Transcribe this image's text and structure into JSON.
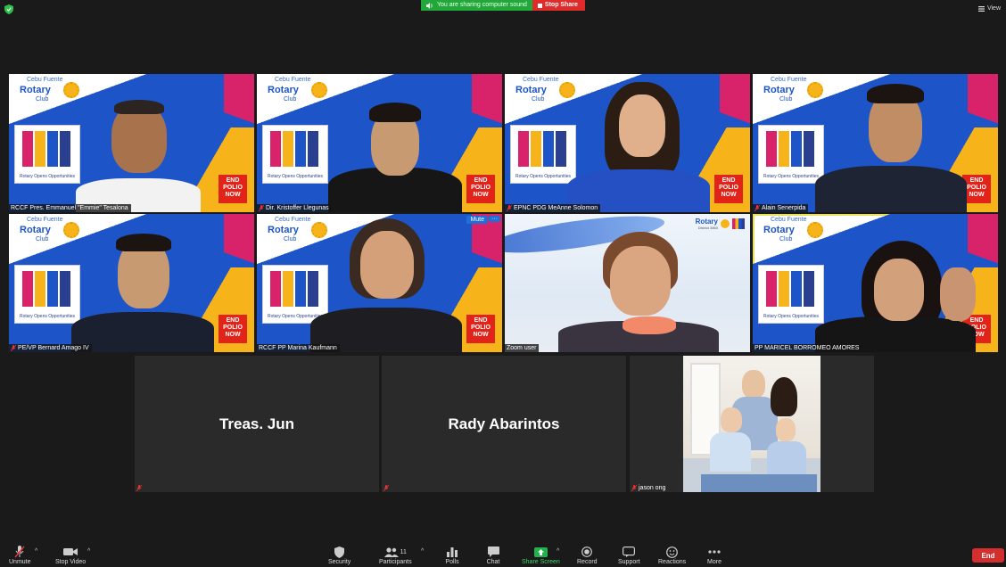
{
  "sharing": {
    "message": "You are sharing computer sound",
    "stop_label": "Stop Share"
  },
  "view_label": "View",
  "participants": [
    {
      "name": "RCCF Pres. Emmanuel \"Emmie\" Tesalona",
      "muted": false,
      "background": "rotary"
    },
    {
      "name": "Dir. Kristoffer Llegunas",
      "muted": true,
      "background": "rotary"
    },
    {
      "name": "EPNC PDG MeAnne Solomon",
      "muted": true,
      "background": "rotary"
    },
    {
      "name": "Alain Senerpida",
      "muted": true,
      "background": "rotary"
    },
    {
      "name": "PE/VP Bernard Amago IV",
      "muted": true,
      "background": "rotary"
    },
    {
      "name": "RCCF PP Marina Kaufmann",
      "muted": false,
      "background": "rotary"
    },
    {
      "name": "Zoom user",
      "muted": false,
      "background": "district"
    },
    {
      "name": "PP MARICEL BORROMEO AMORES",
      "muted": false,
      "background": "rotary",
      "speaking": true
    },
    {
      "name": "Treas. Jun",
      "muted": true,
      "video": false
    },
    {
      "name": "Rady Abarintos",
      "muted": true,
      "video": false
    },
    {
      "name": "jason ong",
      "muted": true,
      "video": true
    }
  ],
  "tile_controls": {
    "mute_label": "Mute",
    "more_label": "···"
  },
  "virtual_bg": {
    "club_line1": "Cebu Fuente",
    "club_line2": "Rotary",
    "club_line3": "Club",
    "doors_caption": "Rotary Opens Opportunities",
    "end_polio": [
      "END",
      "POLIO",
      "NOW"
    ],
    "district_label": "Rotary",
    "district_sub": "District 3860"
  },
  "toolbar": {
    "unmute": "Unmute",
    "stop_video": "Stop Video",
    "security": "Security",
    "participants": "Participants",
    "participants_count": "11",
    "polls": "Polls",
    "chat": "Chat",
    "share_screen": "Share Screen",
    "record": "Record",
    "support": "Support",
    "reactions": "Reactions",
    "more": "More",
    "end": "End"
  },
  "colors": {
    "share_green": "#22a83a",
    "stop_red": "#e02b2b",
    "rotary_blue": "#1d55c8",
    "rotary_gold": "#f6b41a",
    "speaker_outline": "#e8e05a",
    "end_red": "#d32f2f"
  }
}
